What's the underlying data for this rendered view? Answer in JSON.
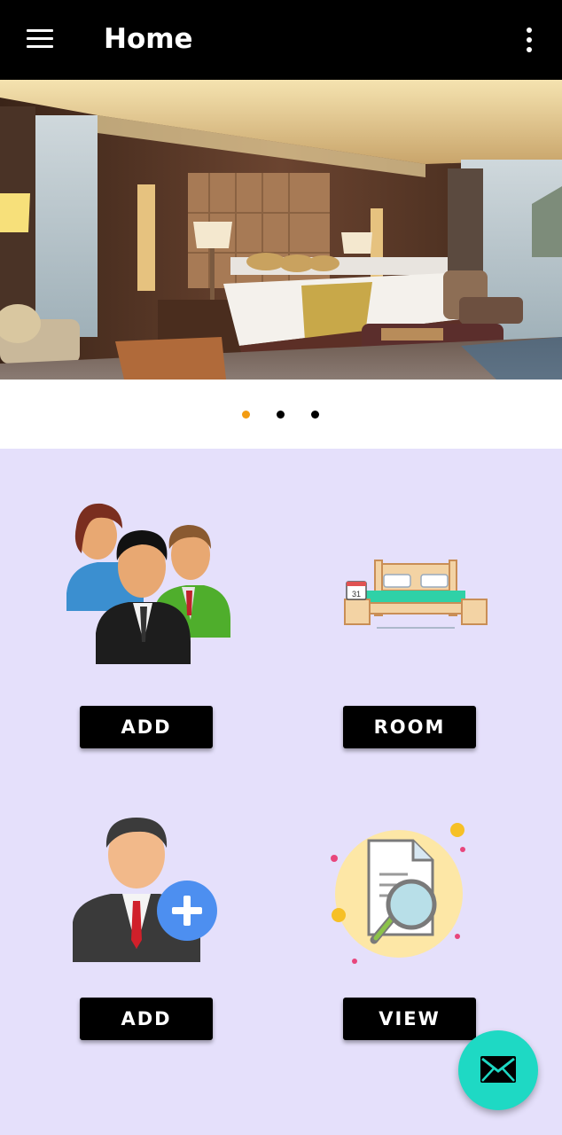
{
  "appbar": {
    "title": "Home",
    "menu_icon": "hamburger-menu-icon",
    "overflow_icon": "more-vert-icon"
  },
  "carousel": {
    "slide_count": 3,
    "active_index": 0,
    "active_dot_color": "#f39c12",
    "image_subject": "hotel-room-photo"
  },
  "tiles": [
    {
      "icon": "group-users-icon",
      "button_label": "ADD"
    },
    {
      "icon": "bed-room-icon",
      "button_label": "ROOM"
    },
    {
      "icon": "add-person-icon",
      "button_label": "ADD"
    },
    {
      "icon": "document-search-icon",
      "button_label": "VIEW"
    }
  ],
  "fab": {
    "icon": "mail-icon",
    "color": "#1ed9c4"
  },
  "colors": {
    "appbar": "#000000",
    "grid_background": "#e5e0fb",
    "button": "#000000"
  }
}
